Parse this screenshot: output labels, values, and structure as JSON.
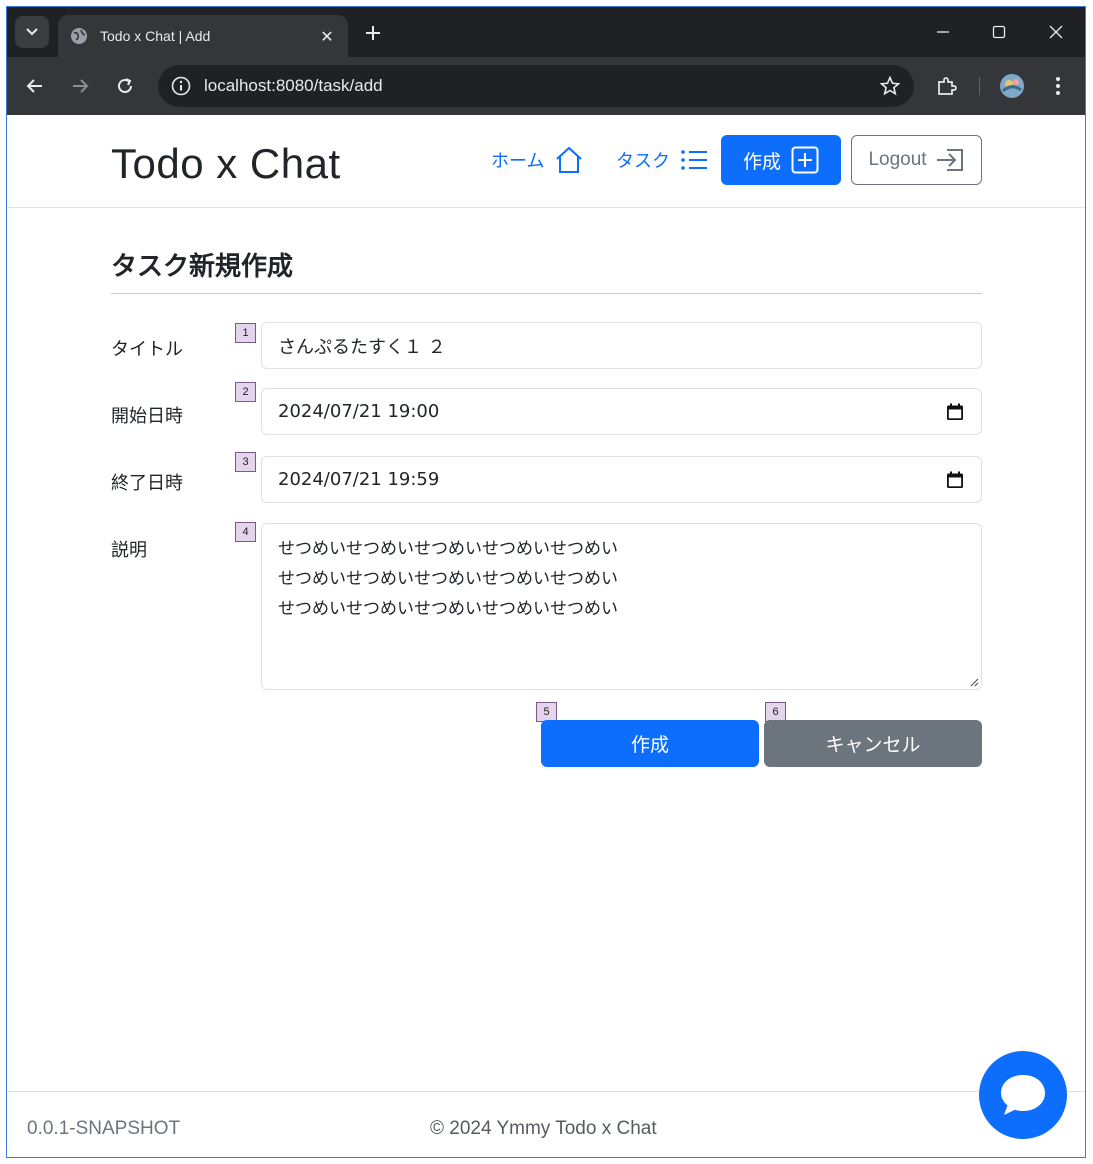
{
  "browser": {
    "tab_title": "Todo x Chat | Add",
    "url": "localhost:8080/task/add"
  },
  "navbar": {
    "brand": "Todo x Chat",
    "home_label": "ホーム",
    "tasks_label": "タスク",
    "create_label": "作成",
    "logout_label": "Logout"
  },
  "form": {
    "heading": "タスク新規作成",
    "title_label": "タイトル",
    "title_value": "さんぷるたすく１ ２",
    "start_label": "開始日時",
    "start_value": "2024/07/21 19:00",
    "end_label": "終了日時",
    "end_value": "2024/07/21 19:59",
    "description_label": "説明",
    "description_lines": [
      "せつめいせつめいせつめいせつめいせつめい",
      "せつめいせつめいせつめいせつめいせつめい",
      "せつめいせつめいせつめいせつめいせつめい"
    ],
    "submit_label": "作成",
    "cancel_label": "キャンセル"
  },
  "markers": [
    "1",
    "2",
    "3",
    "4",
    "5",
    "6"
  ],
  "footer": {
    "version": "0.0.1-SNAPSHOT",
    "copyright": "© 2024 Ymmy Todo x Chat"
  },
  "colors": {
    "primary": "#0d6efd",
    "secondary": "#6c757d",
    "chrome_dark": "#202124",
    "chrome_toolbar": "#35363a"
  }
}
